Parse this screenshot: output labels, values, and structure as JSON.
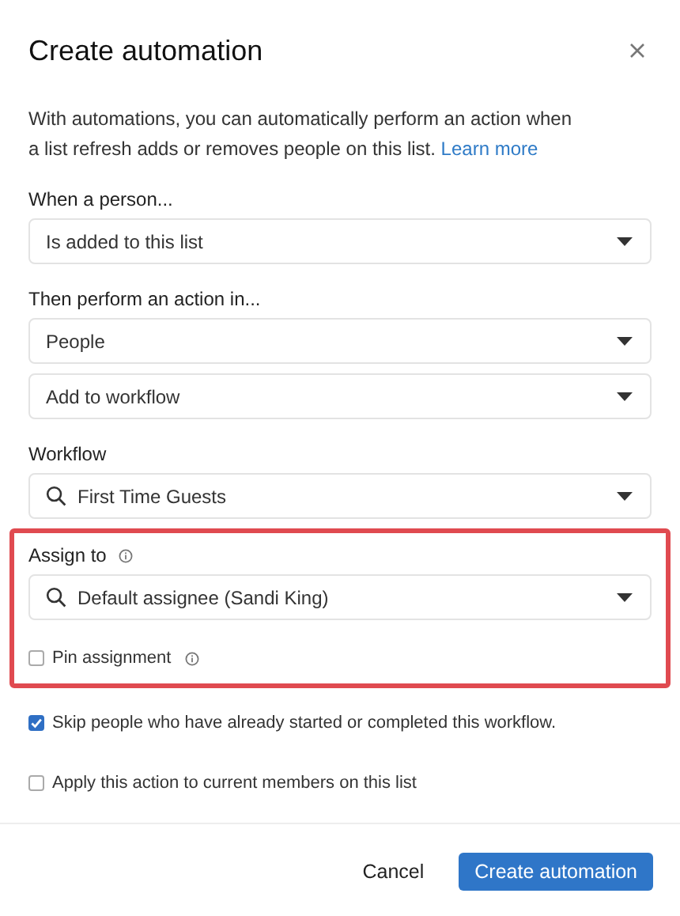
{
  "dialog": {
    "title": "Create automation",
    "description": "With automations, you can automatically perform an action when a list refresh adds or removes people on this list.",
    "learn_more": "Learn more"
  },
  "sections": [
    {
      "label": "When a person...",
      "selects": [
        {
          "value": "Is added to this list"
        }
      ]
    },
    {
      "label": "Then perform an action in...",
      "selects": [
        {
          "value": "People"
        },
        {
          "value": "Add to workflow"
        }
      ]
    },
    {
      "label": "Workflow",
      "selects": [
        {
          "value": "First Time Guests",
          "search": true
        }
      ]
    },
    {
      "label": "Assign to",
      "info": true,
      "highlighted": true,
      "selects": [
        {
          "value": "Default assignee (Sandi King)",
          "search": true
        }
      ],
      "checkboxes": [
        {
          "label": "Pin assignment",
          "checked": false,
          "info": true
        }
      ]
    }
  ],
  "options": [
    {
      "label": "Skip people who have already started or completed this workflow.",
      "checked": true
    },
    {
      "label": "Apply this action to current members on this list",
      "checked": false
    }
  ],
  "buttons": [
    {
      "label": "Cancel"
    },
    {
      "label": "Create automation",
      "primary": true
    }
  ]
}
